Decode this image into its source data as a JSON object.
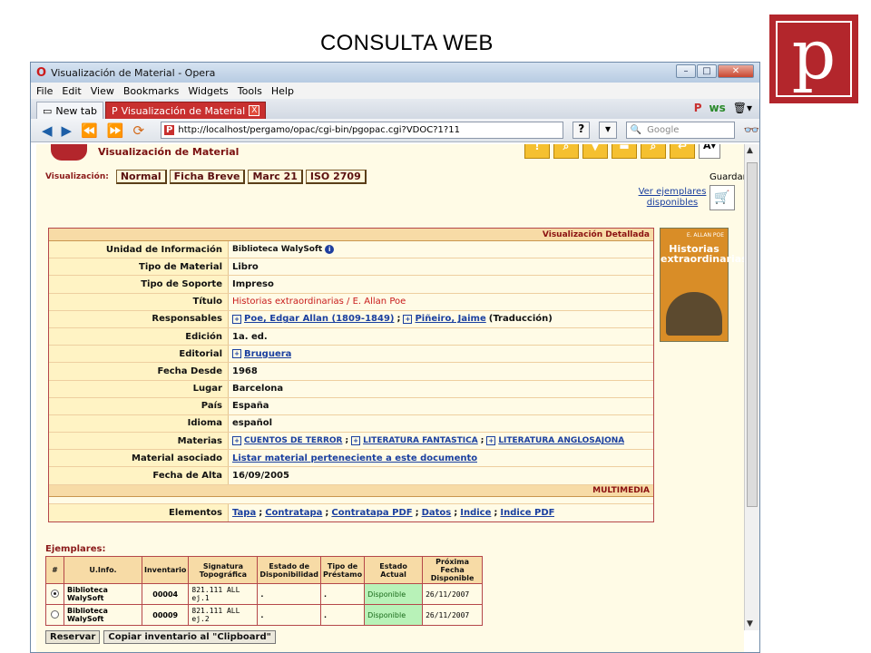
{
  "slide": {
    "title": "CONSULTA WEB",
    "logo_letter": "p"
  },
  "window": {
    "title": "Visualización de Material - Opera",
    "menu": [
      "File",
      "Edit",
      "View",
      "Bookmarks",
      "Widgets",
      "Tools",
      "Help"
    ],
    "tabs": [
      {
        "label": "New tab",
        "active": false
      },
      {
        "label": "Visualización de Material",
        "active": true
      }
    ],
    "url": "http://localhost/pergamo/opac/cgi-bin/pgopac.cgi?VDOC?1?11",
    "search_placeholder": "Google"
  },
  "page": {
    "title": "Visualización de Material",
    "visualizacion_label": "Visualización:",
    "view_buttons": [
      "Normal",
      "Ficha Breve",
      "Marc 21",
      "ISO 2709"
    ],
    "guardar": "Guardar",
    "ver_ejemplares": "Ver ejemplares disponibles",
    "font_button": "A",
    "detail_header": "Visualización Detallada",
    "fields": [
      {
        "key": "Unidad de Información",
        "value": "Biblioteca WalySoft"
      },
      {
        "key": "Tipo de Material",
        "value": "Libro"
      },
      {
        "key": "Tipo de Soporte",
        "value": "Impreso"
      },
      {
        "key": "Título",
        "value": "Historias extraordinarias / E. Allan Poe"
      },
      {
        "key": "Responsables",
        "link1": "Poe, Edgar Allan (1809-1849)",
        "sep": ";",
        "link2": "Piñeiro, Jaime",
        "note": "(Traducción)"
      },
      {
        "key": "Edición",
        "value": "1a. ed."
      },
      {
        "key": "Editorial",
        "link1": "Bruguera"
      },
      {
        "key": "Fecha Desde",
        "value": "1968"
      },
      {
        "key": "Lugar",
        "value": "Barcelona"
      },
      {
        "key": "País",
        "value": "España"
      },
      {
        "key": "Idioma",
        "value": "español"
      },
      {
        "key": "Materias",
        "link1": "CUENTOS DE TERROR",
        "link2": "LITERATURA FANTASTICA",
        "link3": "LITERATURA ANGLOSAJONA"
      },
      {
        "key": "Material asociado",
        "link1": "Listar material perteneciente a este documento"
      },
      {
        "key": "Fecha de Alta",
        "value": "16/09/2005"
      }
    ],
    "multimedia_header": "MULTIMEDIA",
    "elementos": {
      "key": "Elementos",
      "links": [
        "Tapa",
        "Contratapa",
        "Contratapa PDF",
        "Datos",
        "Indice",
        "Indice PDF"
      ]
    },
    "cover": {
      "author": "E. ALLAN POE",
      "title": "Historias extraordinarias"
    },
    "ejemplares_label": "Ejemplares:",
    "table": {
      "headers": [
        "#",
        "U.Info.",
        "Inventario",
        "Signatura Topográfica",
        "Estado de Disponibilidad",
        "Tipo de Préstamo",
        "Estado Actual",
        "Próxima Fecha Disponible"
      ],
      "rows": [
        [
          "",
          "Biblioteca WalySoft",
          "00004",
          "821.111 ALL ej.1",
          ".",
          ".",
          "Disponible",
          "26/11/2007"
        ],
        [
          "",
          "Biblioteca WalySoft",
          "00009",
          "821.111 ALL ej.2",
          ".",
          ".",
          "Disponible",
          "26/11/2007"
        ]
      ]
    },
    "buttons": {
      "reservar": "Reservar",
      "copiar": "Copiar inventario al \"Clipboard\""
    }
  }
}
